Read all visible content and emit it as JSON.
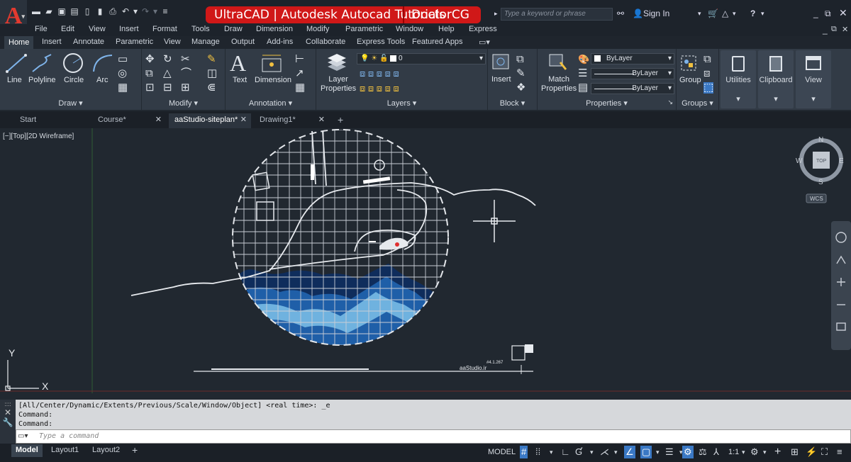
{
  "app": {
    "logo_letter": "A",
    "logo_caret": "▾"
  },
  "banner": {
    "left": "UltraCAD | Autodesk Autocad Tutorials",
    "right": "DoctorCG"
  },
  "search": {
    "placeholder": "Type a keyword or phrase",
    "signin": "Sign In"
  },
  "menu": [
    "File",
    "Edit",
    "View",
    "Insert",
    "Format",
    "Tools",
    "Draw",
    "Dimension",
    "Modify",
    "Parametric",
    "Window",
    "Help",
    "Express"
  ],
  "ribbon_tabs": [
    "Home",
    "Insert",
    "Annotate",
    "Parametric",
    "View",
    "Manage",
    "Output",
    "Add-ins",
    "Collaborate",
    "Express Tools",
    "Featured Apps"
  ],
  "draw": {
    "title": "Draw",
    "line": "Line",
    "polyline": "Polyline",
    "circle": "Circle",
    "arc": "Arc"
  },
  "modify": {
    "title": "Modify"
  },
  "annotation": {
    "title": "Annotation",
    "text": "Text",
    "dimension": "Dimension"
  },
  "layers": {
    "title": "Layers",
    "layer_props_1": "Layer",
    "layer_props_2": "Properties",
    "current_layer": "0"
  },
  "block": {
    "title": "Block",
    "insert": "Insert"
  },
  "properties": {
    "title": "Properties",
    "match_1": "Match",
    "match_2": "Properties",
    "color": "ByLayer",
    "linetype": "ByLayer",
    "lineweight": "ByLayer"
  },
  "groups": {
    "title": "Groups",
    "group": "Group"
  },
  "big_buttons": {
    "utilities": "Utilities",
    "clipboard": "Clipboard",
    "view": "View"
  },
  "doc_tabs": [
    {
      "label": "Start"
    },
    {
      "label": "Course*"
    },
    {
      "label": "aaStudio-siteplan*"
    },
    {
      "label": "Drawing1*"
    }
  ],
  "viewport": {
    "label": "[−][Top][2D Wireframe]",
    "compass_top": "TOP",
    "compass_n": "N",
    "compass_s": "S",
    "compass_e": "E",
    "compass_w": "W",
    "wcs": "WCS",
    "axis_x": "X",
    "axis_y": "Y",
    "drawing_scale": "#4.1.267",
    "drawing_brand": "aaStudio.ir"
  },
  "command": {
    "history": [
      "[All/Center/Dynamic/Extents/Previous/Scale/Window/Object] <real time>: _e",
      "Command:",
      "Command:"
    ],
    "placeholder": "Type a command"
  },
  "layout_tabs": [
    "Model",
    "Layout1",
    "Layout2"
  ],
  "status": {
    "model": "MODEL",
    "scale": "1:1"
  },
  "colors": {
    "accent_red": "#d01818",
    "water_dark": "#0f2d5c",
    "water_mid": "#1f5fa8",
    "water_light": "#6fb2df"
  }
}
